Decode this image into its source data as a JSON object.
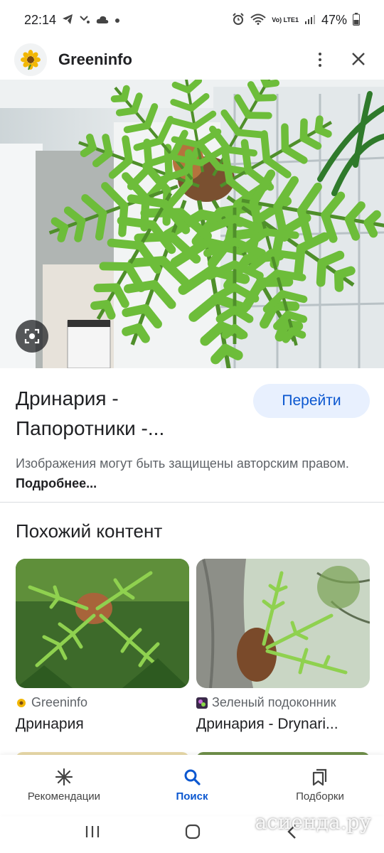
{
  "status_bar": {
    "time": "22:14",
    "battery": "47%",
    "network": "Vo) LTE1"
  },
  "header": {
    "title": "Greeninfo"
  },
  "result": {
    "title": "Дринария - Папоротники -...",
    "visit_label": "Перейти",
    "copyright_text": "Изображения могут быть защищены авторским правом.",
    "more_link": "Подробнее..."
  },
  "similar": {
    "heading": "Похожий контент",
    "items": [
      {
        "source": "Greeninfo",
        "title": "Дринария"
      },
      {
        "source": "Зеленый подоконник",
        "title": "Дринария - Drynari..."
      }
    ]
  },
  "bottom_nav": {
    "items": [
      {
        "label": "Рекомендации",
        "icon": "asterisk-icon"
      },
      {
        "label": "Поиск",
        "icon": "search-icon",
        "active": true
      },
      {
        "label": "Подборки",
        "icon": "collections-icon"
      }
    ]
  },
  "watermark": "асиенда.ру",
  "colors": {
    "accent": "#0b57d0",
    "visit_button_bg": "#e8f0fe",
    "text_secondary": "#5f6368"
  }
}
